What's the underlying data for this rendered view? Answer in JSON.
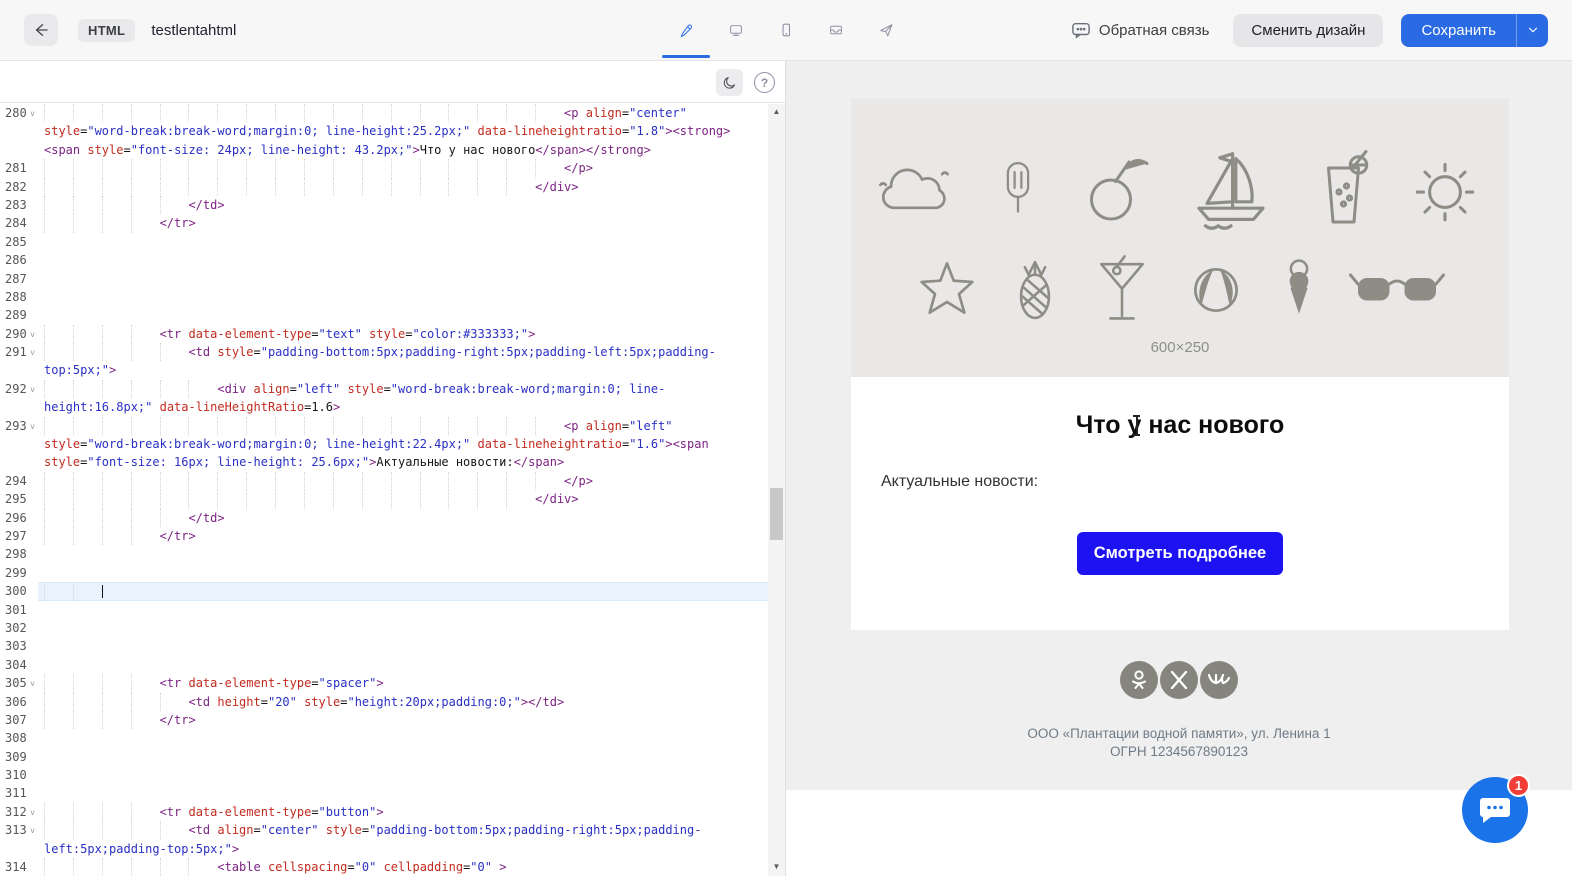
{
  "toolbar": {
    "file_type_badge": "HTML",
    "file_name": "testlentahtml",
    "feedback_label": "Обратная связь",
    "change_design_label": "Сменить дизайн",
    "save_label": "Сохранить",
    "accent_color": "#2a6ae2"
  },
  "editor": {
    "active_line": 300,
    "lines": [
      {
        "n": 280,
        "f": 1,
        "i": 18,
        "r": [
          [
            [
              "t",
              "<p"
            ],
            [
              "p",
              " "
            ],
            [
              "a",
              "align"
            ],
            [
              "p",
              "="
            ],
            [
              "s",
              "\"center\""
            ]
          ],
          [
            [
              "a",
              "style"
            ],
            [
              "p",
              "="
            ],
            [
              "s",
              "\"word-break:break-word;margin:0; line-height:25.2px;\""
            ],
            [
              "p",
              " "
            ],
            [
              "a",
              "data-lineheightratio"
            ],
            [
              "p",
              "="
            ],
            [
              "s",
              "\"1.8\""
            ],
            [
              "t",
              "><strong>"
            ]
          ],
          [
            [
              "t",
              "<span"
            ],
            [
              "p",
              " "
            ],
            [
              "a",
              "style"
            ],
            [
              "p",
              "="
            ],
            [
              "s",
              "\"font-size: 24px; line-height: 43.2px;\""
            ],
            [
              "t",
              ">"
            ],
            [
              "p",
              "Что у нас нового"
            ],
            [
              "t",
              "</span></strong>"
            ]
          ]
        ]
      },
      {
        "n": 281,
        "i": 18,
        "r": [
          [
            [
              "t",
              "</p>"
            ]
          ]
        ]
      },
      {
        "n": 282,
        "i": 17,
        "r": [
          [
            [
              "t",
              "</div>"
            ]
          ]
        ]
      },
      {
        "n": 283,
        "i": 5,
        "r": [
          [
            [
              "t",
              "</td>"
            ]
          ]
        ]
      },
      {
        "n": 284,
        "i": 4,
        "r": [
          [
            [
              "t",
              "</tr>"
            ]
          ]
        ]
      },
      {
        "n": 285,
        "r": [
          []
        ]
      },
      {
        "n": 286,
        "r": [
          []
        ]
      },
      {
        "n": 287,
        "r": [
          []
        ]
      },
      {
        "n": 288,
        "r": [
          []
        ]
      },
      {
        "n": 289,
        "r": [
          []
        ]
      },
      {
        "n": 290,
        "f": 1,
        "i": 4,
        "r": [
          [
            [
              "t",
              "<tr"
            ],
            [
              "p",
              " "
            ],
            [
              "a",
              "data-element-type"
            ],
            [
              "p",
              "="
            ],
            [
              "s",
              "\"text\""
            ],
            [
              "p",
              " "
            ],
            [
              "a",
              "style"
            ],
            [
              "p",
              "="
            ],
            [
              "s",
              "\"color:#333333;\""
            ],
            [
              "t",
              ">"
            ]
          ]
        ]
      },
      {
        "n": 291,
        "f": 1,
        "i": 5,
        "r": [
          [
            [
              "t",
              "<td"
            ],
            [
              "p",
              " "
            ],
            [
              "a",
              "style"
            ],
            [
              "p",
              "="
            ],
            [
              "s",
              "\"padding-bottom:5px;padding-right:5px;padding-left:5px;padding-"
            ]
          ],
          [
            [
              "s",
              "top:5px;\""
            ],
            [
              "t",
              ">"
            ]
          ]
        ]
      },
      {
        "n": 292,
        "f": 1,
        "i": 6,
        "r": [
          [
            [
              "t",
              "<div"
            ],
            [
              "p",
              " "
            ],
            [
              "a",
              "align"
            ],
            [
              "p",
              "="
            ],
            [
              "s",
              "\"left\""
            ],
            [
              "p",
              " "
            ],
            [
              "a",
              "style"
            ],
            [
              "p",
              "="
            ],
            [
              "s",
              "\"word-break:break-word;margin:0; line-"
            ]
          ],
          [
            [
              "s",
              "height:16.8px;\""
            ],
            [
              "p",
              " "
            ],
            [
              "a",
              "data-lineHeightRatio"
            ],
            [
              "p",
              "=1.6"
            ],
            [
              "t",
              ">"
            ]
          ]
        ]
      },
      {
        "n": 293,
        "f": 1,
        "i": 18,
        "r": [
          [
            [
              "t",
              "<p"
            ],
            [
              "p",
              " "
            ],
            [
              "a",
              "align"
            ],
            [
              "p",
              "="
            ],
            [
              "s",
              "\"left\""
            ]
          ],
          [
            [
              "a",
              "style"
            ],
            [
              "p",
              "="
            ],
            [
              "s",
              "\"word-break:break-word;margin:0; line-height:22.4px;\""
            ],
            [
              "p",
              " "
            ],
            [
              "a",
              "data-lineheightratio"
            ],
            [
              "p",
              "="
            ],
            [
              "s",
              "\"1.6\""
            ],
            [
              "t",
              "><span"
            ]
          ],
          [
            [
              "a",
              "style"
            ],
            [
              "p",
              "="
            ],
            [
              "s",
              "\"font-size: 16px; line-height: 25.6px;\""
            ],
            [
              "t",
              ">"
            ],
            [
              "p",
              "Актуальные новости:"
            ],
            [
              "t",
              "</span>"
            ]
          ]
        ]
      },
      {
        "n": 294,
        "i": 18,
        "r": [
          [
            [
              "t",
              "</p>"
            ]
          ]
        ]
      },
      {
        "n": 295,
        "i": 17,
        "r": [
          [
            [
              "t",
              "</div>"
            ]
          ]
        ]
      },
      {
        "n": 296,
        "i": 5,
        "r": [
          [
            [
              "t",
              "</td>"
            ]
          ]
        ]
      },
      {
        "n": 297,
        "i": 4,
        "r": [
          [
            [
              "t",
              "</tr>"
            ]
          ]
        ]
      },
      {
        "n": 298,
        "r": [
          []
        ]
      },
      {
        "n": 299,
        "r": [
          []
        ]
      },
      {
        "n": 300,
        "i": 2,
        "cur": 1,
        "act": 1,
        "r": [
          []
        ]
      },
      {
        "n": 301,
        "r": [
          []
        ]
      },
      {
        "n": 302,
        "r": [
          []
        ]
      },
      {
        "n": 303,
        "r": [
          []
        ]
      },
      {
        "n": 304,
        "r": [
          []
        ]
      },
      {
        "n": 305,
        "f": 1,
        "i": 4,
        "r": [
          [
            [
              "t",
              "<tr"
            ],
            [
              "p",
              " "
            ],
            [
              "a",
              "data-element-type"
            ],
            [
              "p",
              "="
            ],
            [
              "s",
              "\"spacer\""
            ],
            [
              "t",
              ">"
            ]
          ]
        ]
      },
      {
        "n": 306,
        "i": 5,
        "r": [
          [
            [
              "t",
              "<td"
            ],
            [
              "p",
              " "
            ],
            [
              "a",
              "height"
            ],
            [
              "p",
              "="
            ],
            [
              "s",
              "\"20\""
            ],
            [
              "p",
              " "
            ],
            [
              "a",
              "style"
            ],
            [
              "p",
              "="
            ],
            [
              "s",
              "\"height:20px;padding:0;\""
            ],
            [
              "t",
              "></td>"
            ]
          ]
        ]
      },
      {
        "n": 307,
        "i": 4,
        "r": [
          [
            [
              "t",
              "</tr>"
            ]
          ]
        ]
      },
      {
        "n": 308,
        "r": [
          []
        ]
      },
      {
        "n": 309,
        "r": [
          []
        ]
      },
      {
        "n": 310,
        "r": [
          []
        ]
      },
      {
        "n": 311,
        "r": [
          []
        ]
      },
      {
        "n": 312,
        "f": 1,
        "i": 4,
        "r": [
          [
            [
              "t",
              "<tr"
            ],
            [
              "p",
              " "
            ],
            [
              "a",
              "data-element-type"
            ],
            [
              "p",
              "="
            ],
            [
              "s",
              "\"button\""
            ],
            [
              "t",
              ">"
            ]
          ]
        ]
      },
      {
        "n": 313,
        "f": 1,
        "i": 5,
        "r": [
          [
            [
              "t",
              "<td"
            ],
            [
              "p",
              " "
            ],
            [
              "a",
              "align"
            ],
            [
              "p",
              "="
            ],
            [
              "s",
              "\"center\""
            ],
            [
              "p",
              " "
            ],
            [
              "a",
              "style"
            ],
            [
              "p",
              "="
            ],
            [
              "s",
              "\"padding-bottom:5px;padding-right:5px;padding-"
            ]
          ],
          [
            [
              "s",
              "left:5px;padding-top:5px;\""
            ],
            [
              "t",
              ">"
            ]
          ]
        ]
      },
      {
        "n": 314,
        "i": 6,
        "r": [
          [
            [
              "t",
              "<table"
            ],
            [
              "p",
              " "
            ],
            [
              "a",
              "cellspacing"
            ],
            [
              "p",
              "="
            ],
            [
              "s",
              "\"0\""
            ],
            [
              "p",
              " "
            ],
            [
              "a",
              "cellpadding"
            ],
            [
              "p",
              "="
            ],
            [
              "s",
              "\"0\""
            ],
            [
              "p",
              " "
            ],
            [
              "t",
              ">"
            ]
          ]
        ]
      }
    ]
  },
  "preview": {
    "placeholder_size_label": "600×250",
    "heading": "Что у нас нового",
    "body_text": "Актуальные новости:",
    "button_label": "Смотреть подробнее",
    "button_color": "#1d13f2",
    "social_icons": [
      "odnoklassniki",
      "x-twitter",
      "vk"
    ],
    "footer_line1": "ООО «Плантации водной памяти», ул. Ленина 1",
    "footer_line2": "ОГРН 1234567890123"
  },
  "chat": {
    "badge_count": "1"
  }
}
